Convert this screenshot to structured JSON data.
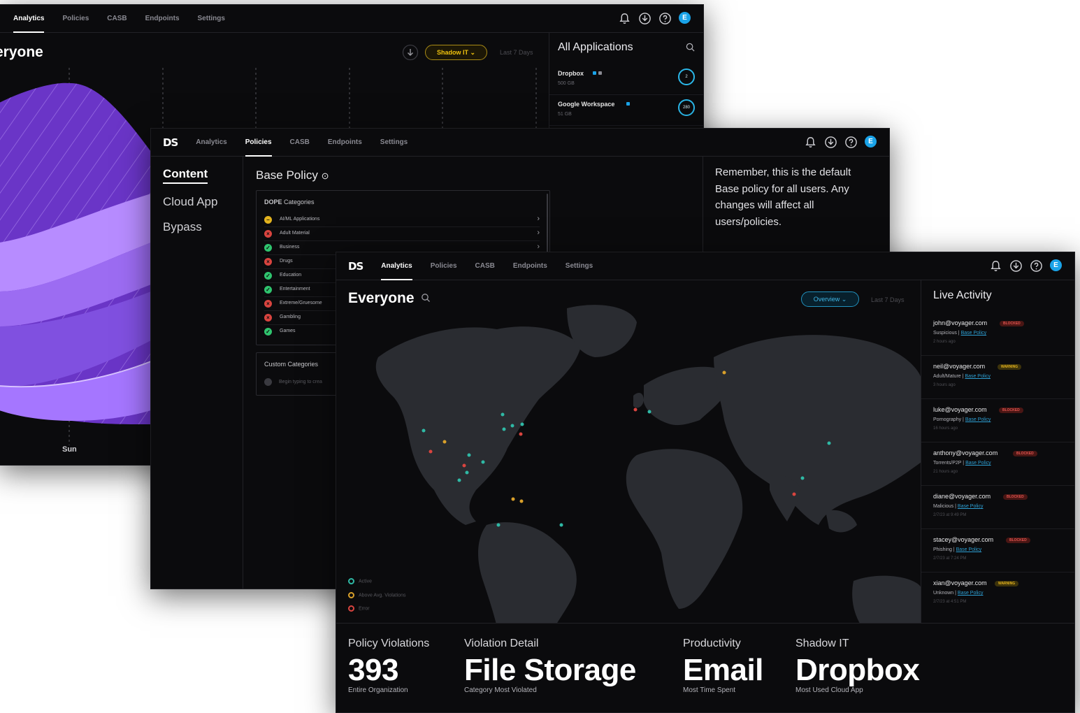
{
  "win1": {
    "tabs": [
      "Analytics",
      "Policies",
      "CASB",
      "Endpoints",
      "Settings"
    ],
    "title": "eryone",
    "filter": "Shadow IT",
    "range": "Last 7 Days",
    "x_label": "Sun",
    "panel_title": "All Applications",
    "apps": [
      {
        "name": "Dropbox",
        "size": "500 GB",
        "ring": "2"
      },
      {
        "name": "Google Workspace",
        "size": "51 GB",
        "ring": "280"
      }
    ]
  },
  "win2": {
    "logo": "DS",
    "tabs": [
      "Analytics",
      "Policies",
      "CASB",
      "Endpoints",
      "Settings"
    ],
    "nav": [
      "Content",
      "Cloud App",
      "Bypass"
    ],
    "policy_title": "Base Policy",
    "categories_head_bold": "DOPE",
    "categories_head": "Categories",
    "categories": [
      {
        "label": "AI/ML Applications",
        "status": "warning"
      },
      {
        "label": "Adult Material",
        "status": "blocked"
      },
      {
        "label": "Business",
        "status": "allowed"
      },
      {
        "label": "Drugs",
        "status": "blocked"
      },
      {
        "label": "Education",
        "status": "allowed"
      },
      {
        "label": "Entertainment",
        "status": "allowed"
      },
      {
        "label": "Extreme/Gruesome",
        "status": "blocked"
      },
      {
        "label": "Gambling",
        "status": "blocked"
      },
      {
        "label": "Games",
        "status": "allowed"
      }
    ],
    "custom_title": "Custom Categories",
    "custom_placeholder": "Begin typing to crea",
    "remember": "Remember, this is the default Base policy for all users. Any changes will affect all users/policies."
  },
  "win3": {
    "logo": "DS",
    "tabs": [
      "Analytics",
      "Policies",
      "CASB",
      "Endpoints",
      "Settings"
    ],
    "title": "Everyone",
    "filter": "Overview",
    "range": "Last 7 Days",
    "legend": [
      {
        "label": "Active",
        "color": "#2fb9a5"
      },
      {
        "label": "Above Avg. Violations",
        "color": "#d9a02a"
      },
      {
        "label": "Error",
        "color": "#d9443f"
      }
    ],
    "live_title": "Live Activity",
    "live": [
      {
        "email": "john@voyager.com",
        "badge": "BLOCKED",
        "category": "Suspicious",
        "policy": "Base Policy",
        "time": "2 hours ago"
      },
      {
        "email": "neil@voyager.com",
        "badge": "WARNING",
        "category": "Adult/Mature",
        "policy": "Base Policy",
        "time": "3 hours ago"
      },
      {
        "email": "luke@voyager.com",
        "badge": "BLOCKED",
        "category": "Pornography",
        "policy": "Base Policy",
        "time": "16 hours ago"
      },
      {
        "email": "anthony@voyager.com",
        "badge": "BLOCKED",
        "category": "Torrents/P2P",
        "policy": "Base Policy",
        "time": "21 hours ago"
      },
      {
        "email": "diane@voyager.com",
        "badge": "BLOCKED",
        "category": "Malicious",
        "policy": "Base Policy",
        "time": "2/7/23 at 9:49 PM"
      },
      {
        "email": "stacey@voyager.com",
        "badge": "BLOCKED",
        "category": "Phishing",
        "policy": "Base Policy",
        "time": "2/7/23 at 7:24 PM"
      },
      {
        "email": "xian@voyager.com",
        "badge": "WARNING",
        "category": "Unknown",
        "policy": "Base Policy",
        "time": "2/7/23 at 4:51 PM"
      }
    ],
    "stats": [
      {
        "label": "Policy Violations",
        "value": "393",
        "sub": "Entire Organization"
      },
      {
        "label": "Violation Detail",
        "value": "File Storage",
        "sub": "Category Most Violated"
      },
      {
        "label": "Productivity",
        "value": "Email",
        "sub": "Most Time Spent"
      },
      {
        "label": "Shadow IT",
        "value": "Dropbox",
        "sub": "Most Used Cloud App"
      }
    ]
  },
  "avatar_letter": "E",
  "colors": {
    "accent_blue": "#1aa3e8",
    "purple": "#8a4ee6",
    "blocked": "#d9443f",
    "warning": "#e2b21e",
    "allowed": "#2fc46e"
  }
}
